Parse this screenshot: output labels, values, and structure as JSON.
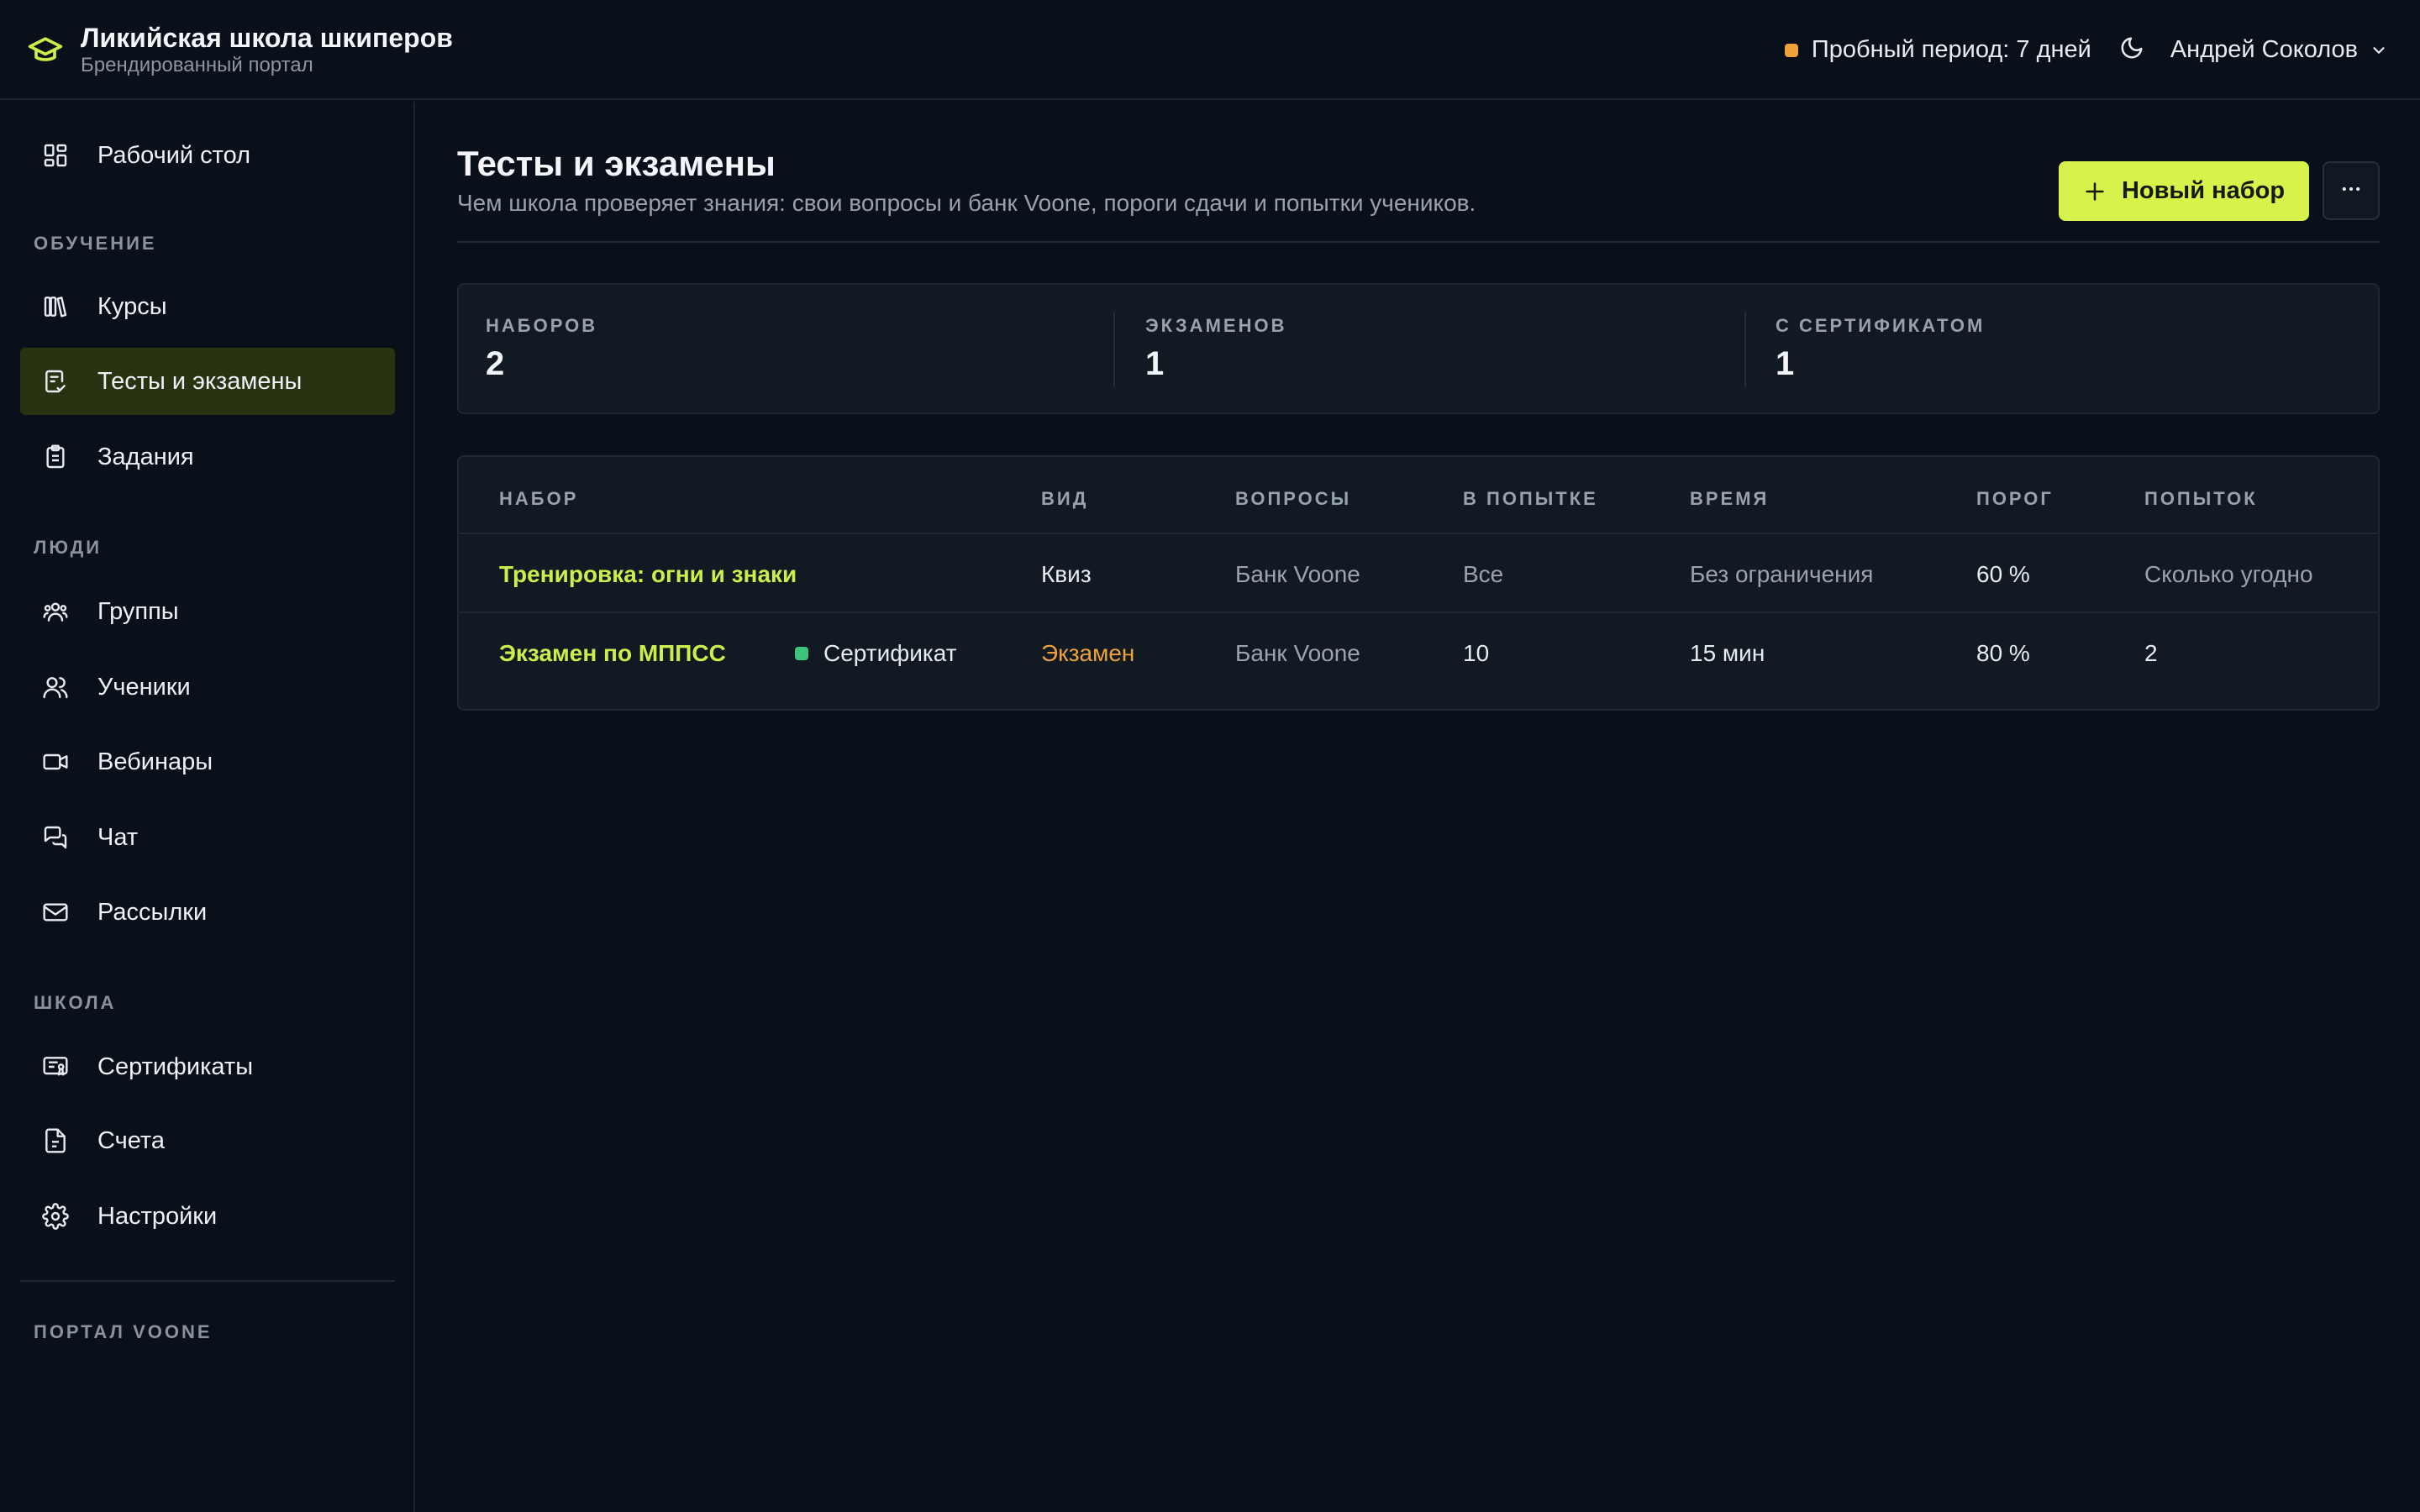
{
  "brand": {
    "title": "Ликийская школа шкиперов",
    "subtitle": "Брендированный портал"
  },
  "topbar": {
    "trial_text": "Пробный период: 7 дней",
    "trial_color": "#f0a23a",
    "theme_icon": "moon-icon",
    "user_name": "Андрей Соколов"
  },
  "sidebar": {
    "dashboard": "Рабочий стол",
    "sections": {
      "learning": "ОБУЧЕНИЕ",
      "people": "ЛЮДИ",
      "school": "ШКОЛА",
      "portal": "ПОРТАЛ VOONE"
    },
    "items": {
      "courses": "Курсы",
      "tests": "Тесты и экзамены",
      "assignments": "Задания",
      "groups": "Группы",
      "students": "Ученики",
      "webinars": "Вебинары",
      "chat": "Чат",
      "mailings": "Рассылки",
      "certificates": "Сертификаты",
      "invoices": "Счета",
      "settings": "Настройки"
    },
    "active": "tests"
  },
  "page": {
    "title": "Тесты и экзамены",
    "subtitle": "Чем школа проверяет знания: свои вопросы и банк Voone, пороги сдачи и попытки учеников.",
    "new_button": "Новый набор",
    "accent_color": "#d7f24a"
  },
  "stats": [
    {
      "label": "НАБОРОВ",
      "value": "2"
    },
    {
      "label": "ЭКЗАМЕНОВ",
      "value": "1"
    },
    {
      "label": "С СЕРТИФИКАТОМ",
      "value": "1"
    }
  ],
  "table": {
    "headers": {
      "set": "НАБОР",
      "kind": "ВИД",
      "questions": "ВОПРОСЫ",
      "per_attempt": "В ПОПЫТКЕ",
      "time": "ВРЕМЯ",
      "threshold": "ПОРОГ",
      "attempts": "ПОПЫТОК"
    },
    "rows": [
      {
        "name": "Тренировка: огни и знаки",
        "badge": "",
        "kind": "Квиз",
        "questions": "Банк Voone",
        "per_attempt": "Все",
        "time": "Без ограничения",
        "threshold": "60 %",
        "attempts": "Сколько угодно"
      },
      {
        "name": "Экзамен по МППСС",
        "badge": "Сертификат",
        "kind": "Экзамен",
        "questions": "Банк Voone",
        "per_attempt": "10",
        "time": "15 мин",
        "threshold": "80 %",
        "attempts": "2"
      }
    ]
  }
}
